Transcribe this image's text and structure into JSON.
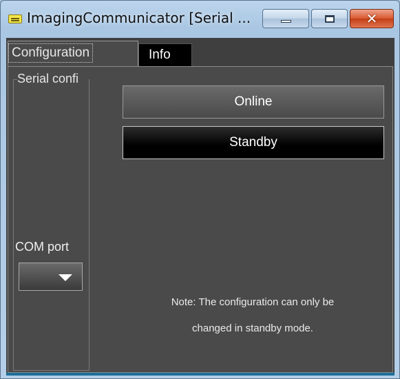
{
  "window": {
    "title": "ImagingCommunicator [Serial ...",
    "controls": {
      "minimize": "minimize",
      "maximize": "maximize",
      "close": "✕"
    }
  },
  "tabs": [
    {
      "label": "Configuration",
      "active": true
    },
    {
      "label": "Info",
      "active": false
    }
  ],
  "serial_config": {
    "group_title": "Serial confi",
    "com_port_label": "COM port",
    "com_port_value": ""
  },
  "buttons": {
    "online": "Online",
    "standby": "Standby"
  },
  "note": {
    "line1": "Note: The configuration can only be",
    "line2": "changed in standby mode."
  },
  "colors": {
    "panel_bg": "#4a4a4a",
    "titlebar_bg": "#b5cfe8",
    "close_button": "#c94b23",
    "accent_bottom": "#1d6f9a"
  }
}
